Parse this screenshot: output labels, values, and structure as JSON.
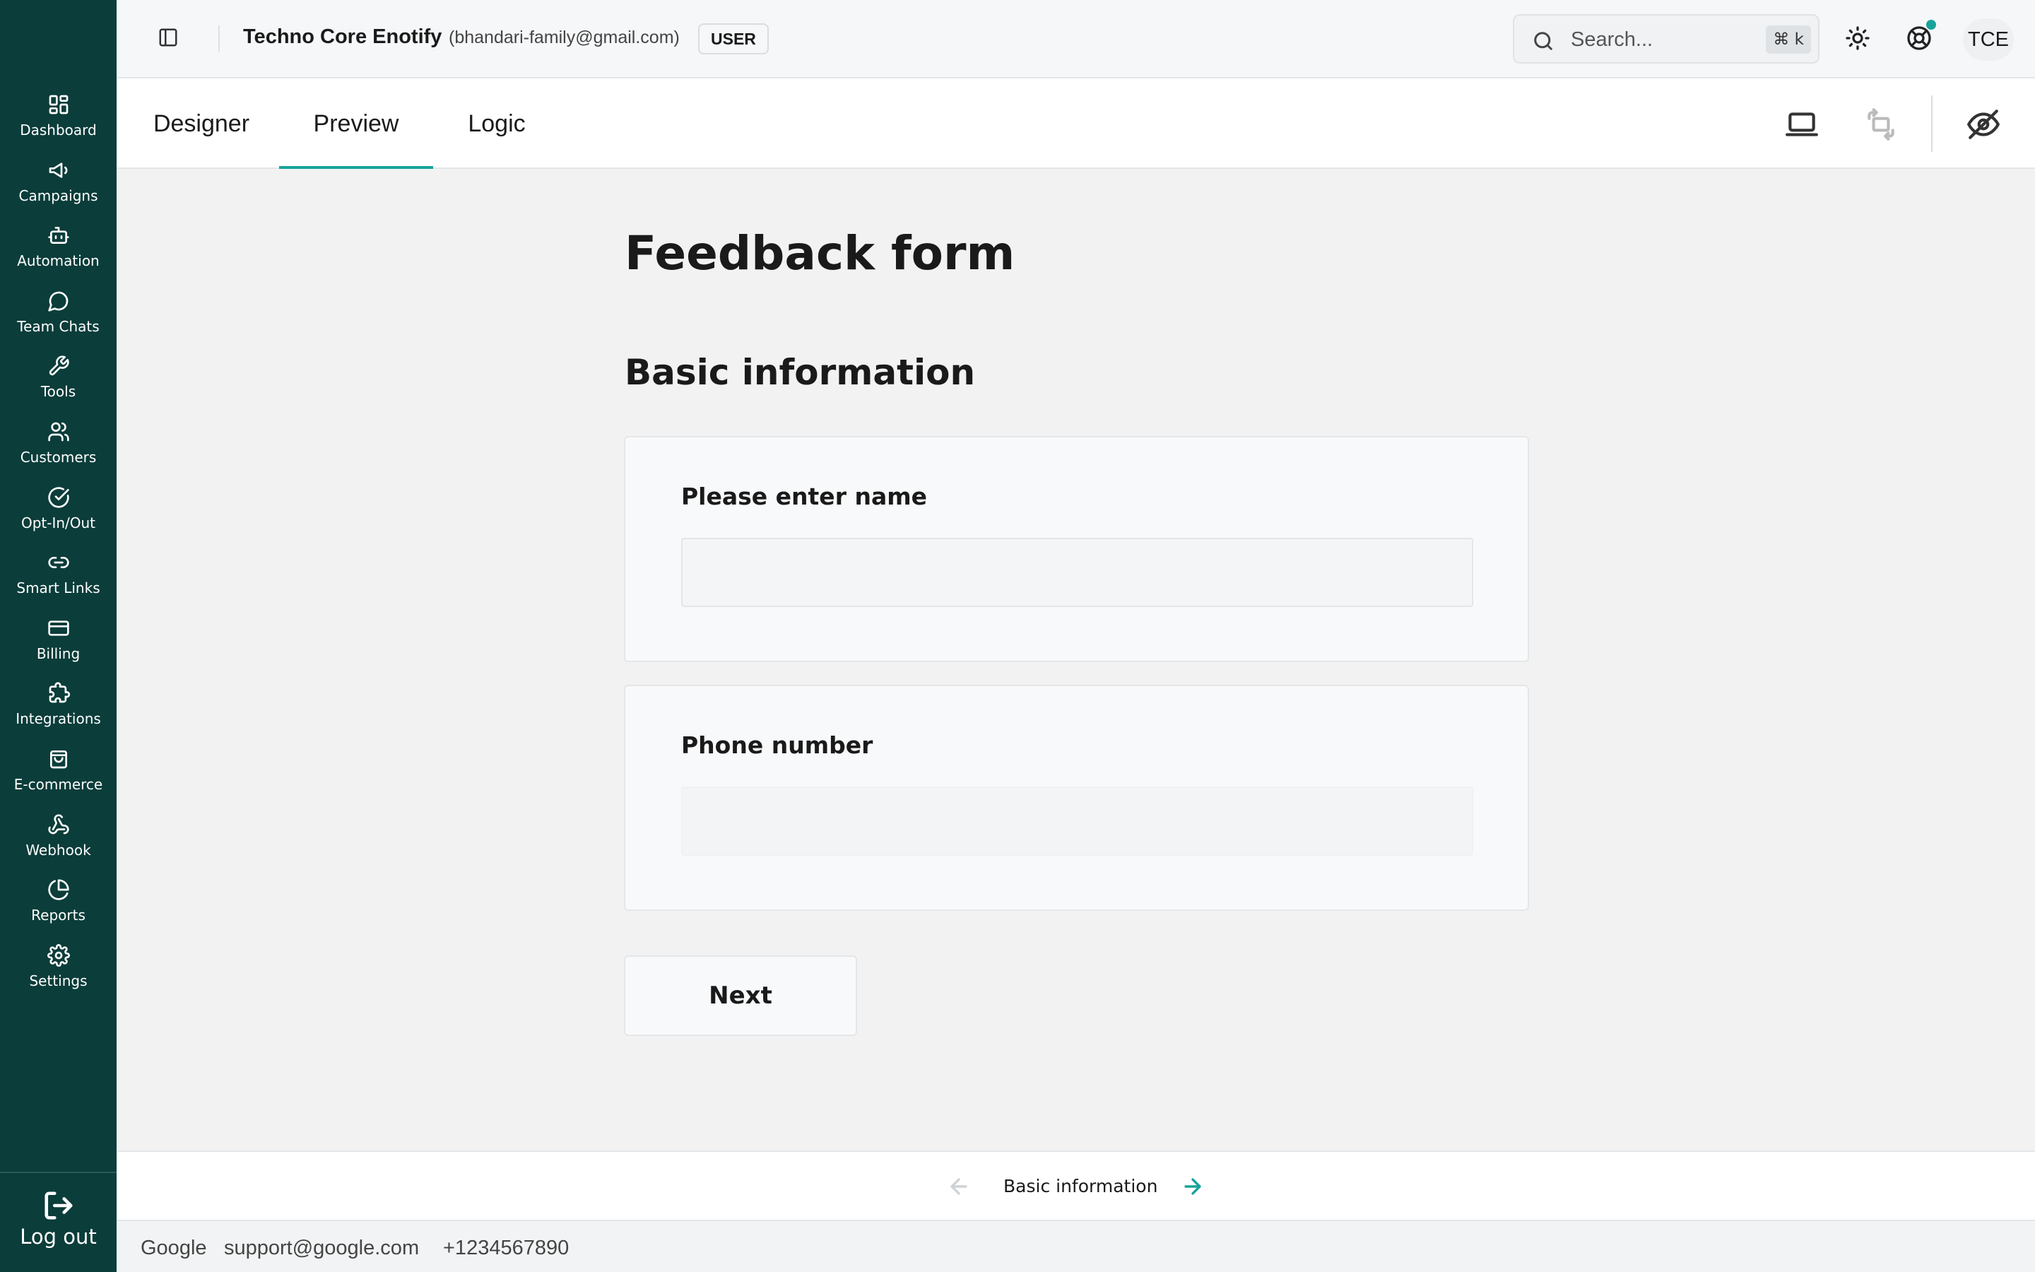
{
  "sidebar": {
    "items": [
      {
        "label": "Dashboard",
        "icon": "dashboard-icon"
      },
      {
        "label": "Campaigns",
        "icon": "megaphone-icon"
      },
      {
        "label": "Automation",
        "icon": "bot-icon"
      },
      {
        "label": "Team Chats",
        "icon": "chat-icon"
      },
      {
        "label": "Tools",
        "icon": "wrench-icon"
      },
      {
        "label": "Customers",
        "icon": "users-icon"
      },
      {
        "label": "Opt-In/Out",
        "icon": "check-circle-icon"
      },
      {
        "label": "Smart Links",
        "icon": "link-icon"
      },
      {
        "label": "Billing",
        "icon": "credit-card-icon"
      },
      {
        "label": "Integrations",
        "icon": "puzzle-icon"
      },
      {
        "label": "E-commerce",
        "icon": "shopping-bag-icon"
      },
      {
        "label": "Webhook",
        "icon": "webhook-icon"
      },
      {
        "label": "Reports",
        "icon": "pie-chart-icon"
      },
      {
        "label": "Settings",
        "icon": "gear-icon"
      }
    ],
    "logout_label": "Log out"
  },
  "header": {
    "app_name": "Techno Core Enotify",
    "email": "(bhandari-family@gmail.com)",
    "role": "USER",
    "search_placeholder": "Search...",
    "search_shortcut": "⌘ k",
    "avatar_initials": "TCE"
  },
  "tabs": [
    {
      "label": "Designer",
      "active": false
    },
    {
      "label": "Preview",
      "active": true
    },
    {
      "label": "Logic",
      "active": false
    }
  ],
  "form": {
    "title": "Feedback form",
    "section_title": "Basic information",
    "questions": [
      {
        "label": "Please enter name",
        "value": ""
      },
      {
        "label": "Phone number",
        "value": ""
      }
    ],
    "next_label": "Next"
  },
  "pager": {
    "current_page": "Basic information"
  },
  "footer": {
    "company": "Google",
    "email": "support@google.com",
    "phone": "+1234567890"
  },
  "colors": {
    "sidebar_bg": "#0b3d3a",
    "accent": "#16a39a",
    "page_bg": "#f2f2f2"
  }
}
